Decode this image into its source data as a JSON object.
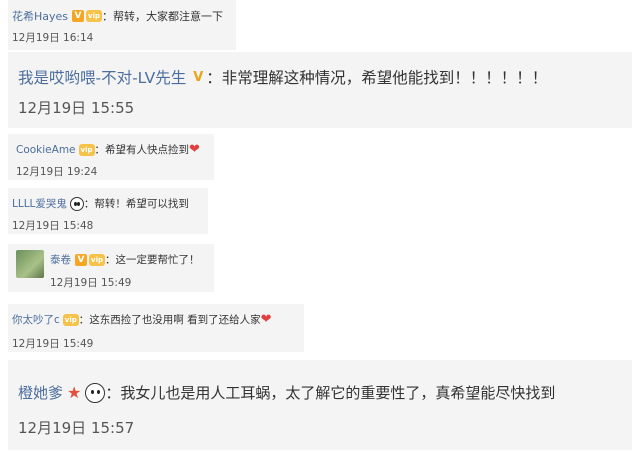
{
  "comments": [
    {
      "user": "花希Hayes",
      "badges": [
        "V",
        "vip"
      ],
      "text": "：帮转，大家都注意一下",
      "time": "12月19日 16:14"
    },
    {
      "user": "我是哎哟喂-不对-LV先生",
      "badges": [
        "V-gold"
      ],
      "text": "：非常理解这种情况，希望他能找到！！！！！！",
      "time": "12月19日 15:55"
    },
    {
      "user": "CookieAme",
      "badges": [
        "vip"
      ],
      "text": "：希望有人快点捡到",
      "trailing": "heart",
      "time": "12月19日 19:24"
    },
    {
      "user": "LLLL爱哭鬼",
      "badges": [
        "panda"
      ],
      "text": "：帮转！希望可以找到",
      "time": "12月19日 15:48"
    },
    {
      "user": "泰卷",
      "badges": [
        "V",
        "vip"
      ],
      "text": "：这一定要帮忙了！",
      "time": "12月19日 15:49"
    },
    {
      "user": "你太吵了c",
      "badges": [
        "vip"
      ],
      "text": "：这东西捡了也没用啊 看到了还给人家",
      "trailing": "heart",
      "time": "12月19日 15:49"
    },
    {
      "user": "橙她爹",
      "badges": [
        "star",
        "panda"
      ],
      "text": "：我女儿也是用人工耳蜗，太了解它的重要性了，真希望能尽快找到",
      "time": "12月19日 15:57"
    }
  ],
  "glyphs": {
    "heart": "❤",
    "star": "★",
    "v": "V",
    "vip_label": "vip"
  },
  "colors": {
    "user": "#4b6e9e",
    "card_bg": "#f4f4f4",
    "v_badge": "#f5a623",
    "heart": "#e04040"
  }
}
